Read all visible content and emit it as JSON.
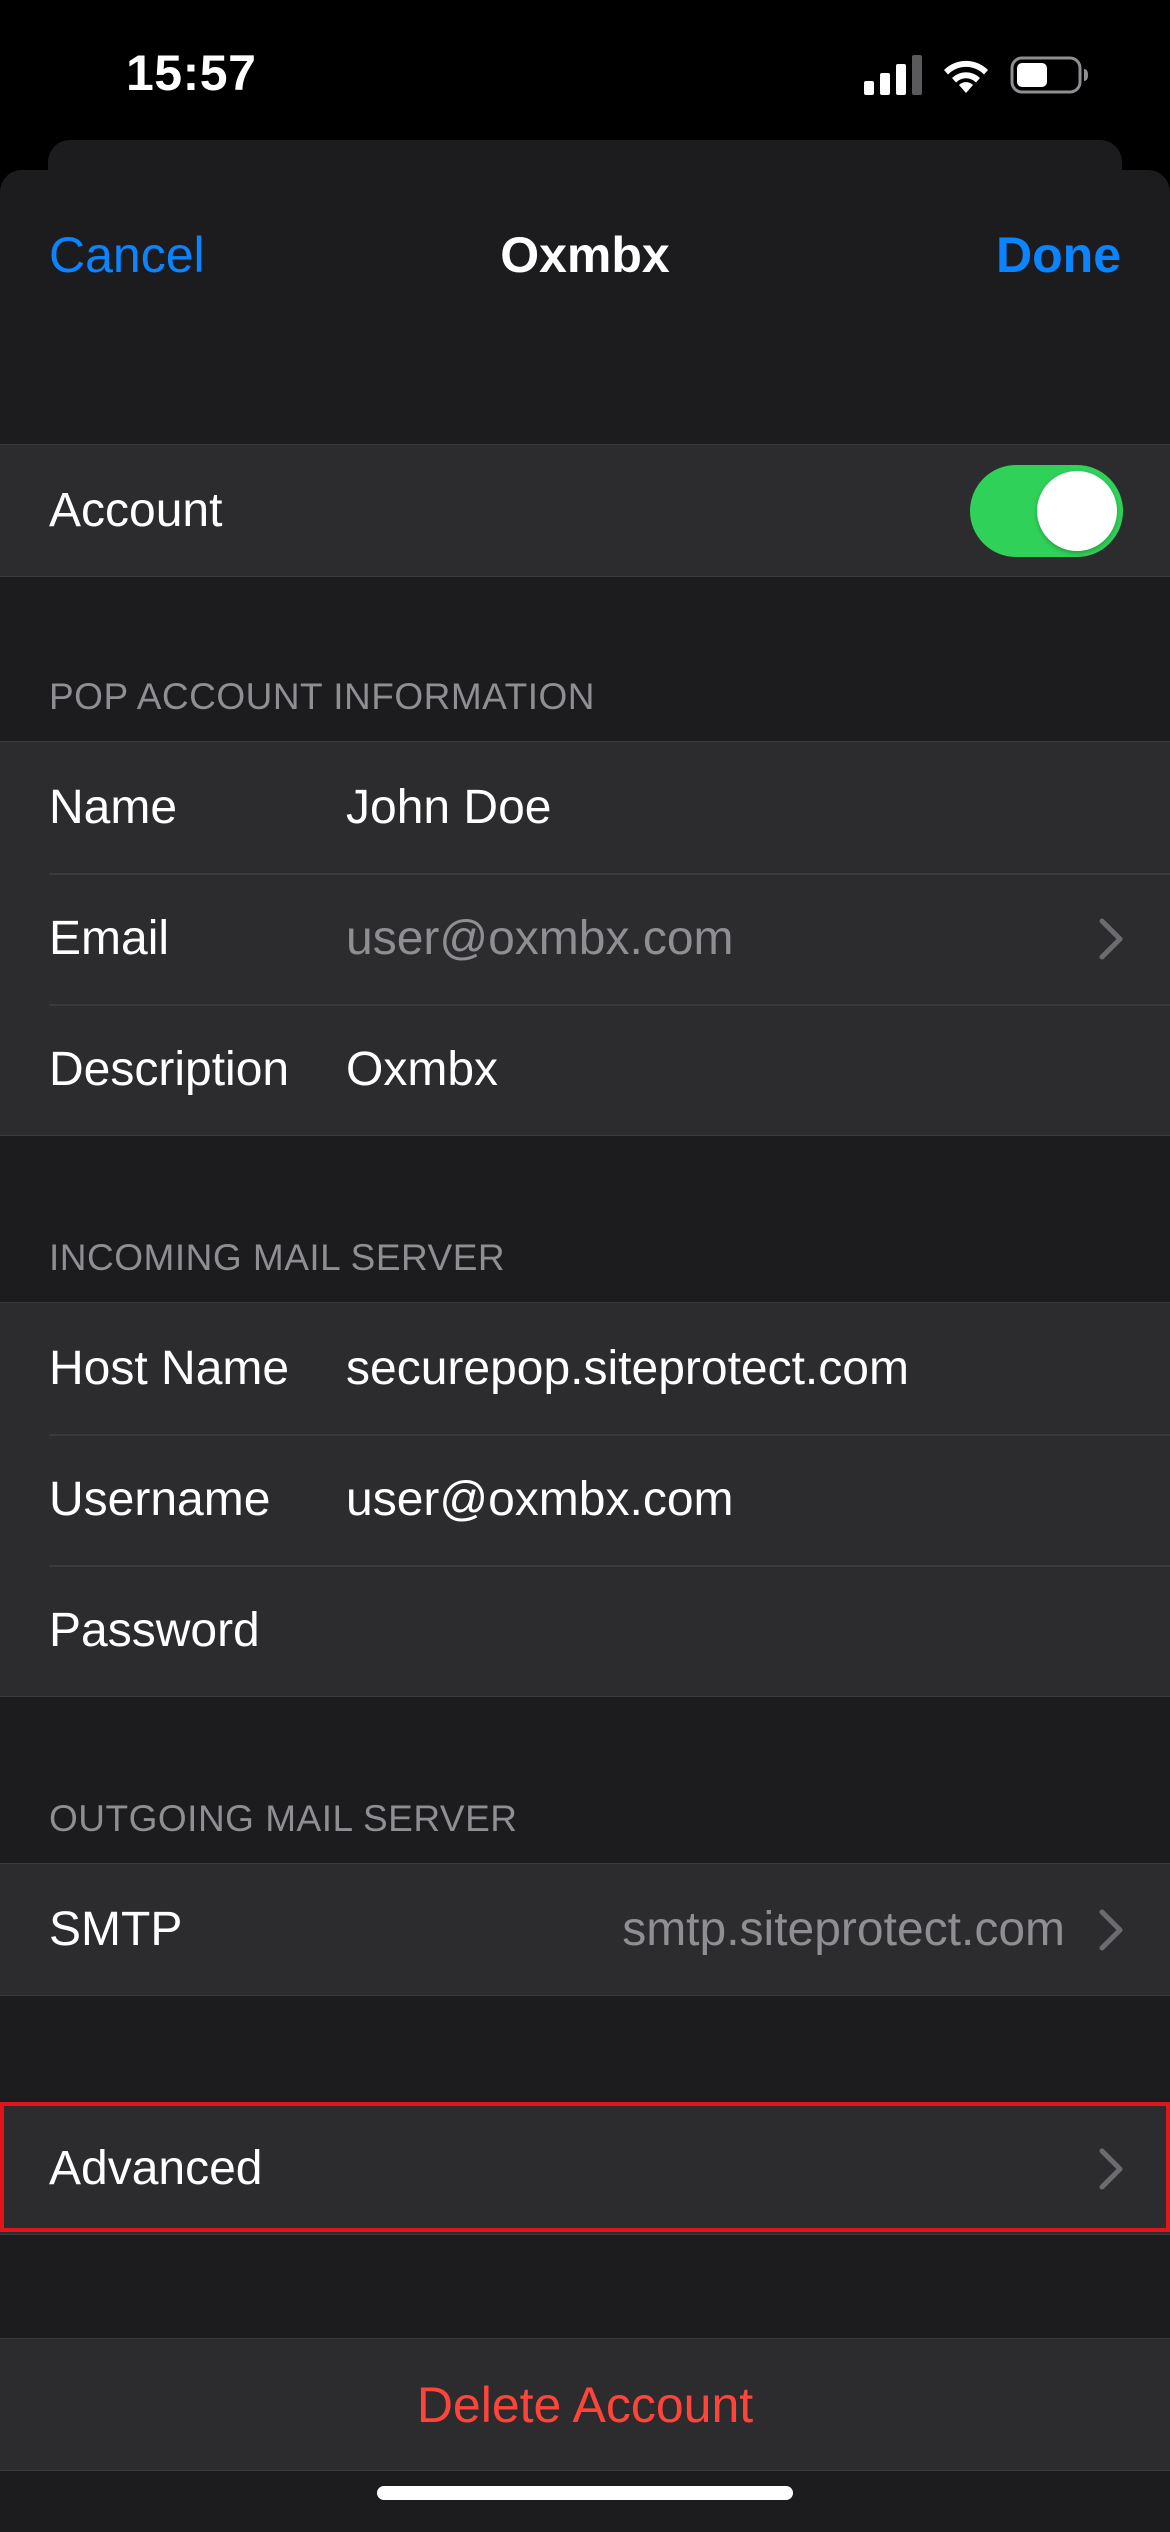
{
  "status_bar": {
    "time": "15:57"
  },
  "nav": {
    "cancel_label": "Cancel",
    "title": "Oxmbx",
    "done_label": "Done"
  },
  "account": {
    "label": "Account",
    "enabled": true,
    "toggle_color": "#30d158"
  },
  "pop_info": {
    "header": "POP ACCOUNT INFORMATION",
    "name_label": "Name",
    "name_value": "John Doe",
    "email_label": "Email",
    "email_value": "user@oxmbx.com",
    "description_label": "Description",
    "description_value": "Oxmbx"
  },
  "incoming": {
    "header": "INCOMING MAIL SERVER",
    "host_label": "Host Name",
    "host_value": "securepop.siteprotect.com",
    "username_label": "Username",
    "username_value": "user@oxmbx.com",
    "password_label": "Password"
  },
  "outgoing": {
    "header": "OUTGOING MAIL SERVER",
    "smtp_label": "SMTP",
    "smtp_value": "smtp.siteprotect.com"
  },
  "advanced": {
    "label": "Advanced",
    "highlight_color": "#e0161c"
  },
  "delete": {
    "label": "Delete Account",
    "color": "#ff453a"
  },
  "colors": {
    "accent": "#0a84ff",
    "background": "#1c1c1e",
    "cell": "#2c2c2e",
    "secondary_text": "#8e8e93"
  }
}
